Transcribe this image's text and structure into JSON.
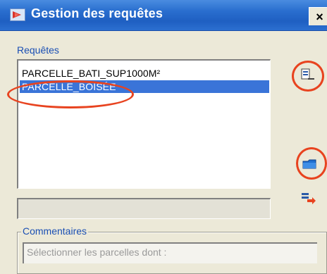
{
  "window": {
    "title": "Gestion des requêtes",
    "close_label": "×",
    "app_icon": "app-icon"
  },
  "requests_section": {
    "label": "Requêtes",
    "items": [
      {
        "label": "PARCELLE_BATI_SUP1000M²",
        "selected": false
      },
      {
        "label": "PARCELLE_BOISÉE",
        "selected": true
      }
    ]
  },
  "side_buttons": [
    {
      "icon": "new-request-icon"
    },
    {
      "icon": "open-folder-icon"
    },
    {
      "icon": "export-arrow-icon"
    }
  ],
  "status_field": {
    "value": ""
  },
  "comments": {
    "legend": "Commentaires",
    "value": "Sélectionner les parcelles dont :"
  },
  "colors": {
    "titlebar": "#2a6fcf",
    "selection": "#3a74d8",
    "annotation": "#e8431f",
    "dialog_bg": "#ece9d8"
  }
}
